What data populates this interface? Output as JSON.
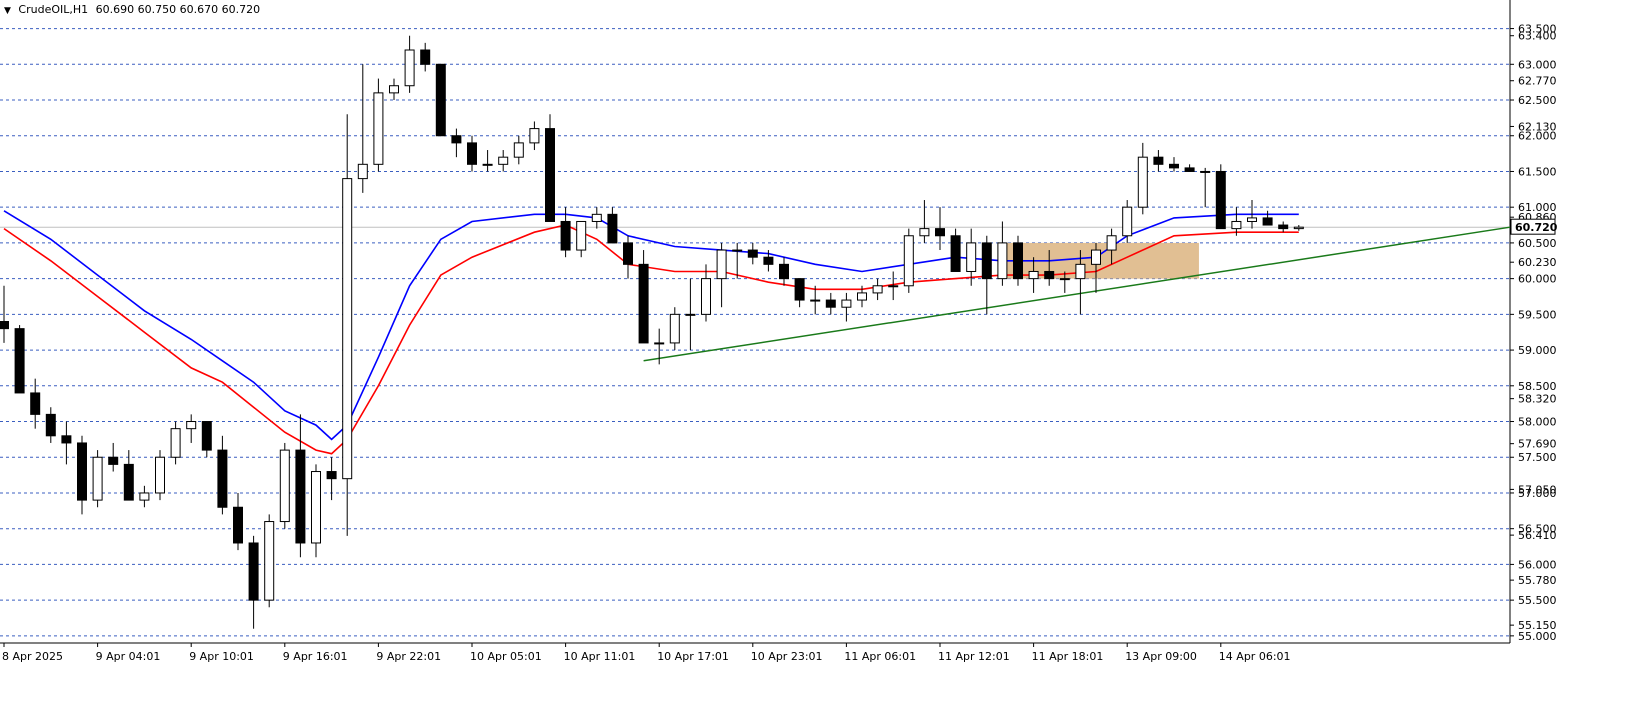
{
  "header": {
    "symbol": "CrudeOIL,H1",
    "ohlc": "60.690 60.750 60.670 60.720",
    "dropdown_icon": "triangle-down-icon"
  },
  "colors": {
    "bull": "#ffffff",
    "bear": "#000000",
    "ma_fast": "#0000ff",
    "ma_slow": "#ff0000",
    "trendline": "#1a7a1a",
    "zone": "#deb887",
    "grid": "#3b5fc0",
    "price_box": "#ffffff"
  },
  "chart_data": {
    "type": "candlestick",
    "ylim": [
      54.9,
      63.62
    ],
    "y_ticks": [
      "63.500",
      "63.400",
      "63.000",
      "62.770",
      "62.500",
      "62.130",
      "62.000",
      "61.500",
      "61.000",
      "60.860",
      "60.500",
      "60.230",
      "60.000",
      "59.500",
      "59.000",
      "58.500",
      "58.320",
      "58.000",
      "57.690",
      "57.500",
      "57.050",
      "57.000",
      "56.500",
      "56.410",
      "56.000",
      "55.780",
      "55.500",
      "55.150",
      "55.000"
    ],
    "grid_levels": [
      63.5,
      63.0,
      62.5,
      62.0,
      61.5,
      61.0,
      60.5,
      60.0,
      59.5,
      59.0,
      58.5,
      58.0,
      57.5,
      57.0,
      56.5,
      56.0,
      55.5,
      55.0
    ],
    "current_price": "60.720",
    "x_labels": [
      "8 Apr 2025",
      "9 Apr 04:01",
      "9 Apr 10:01",
      "9 Apr 16:01",
      "9 Apr 22:01",
      "10 Apr 05:01",
      "10 Apr 11:01",
      "10 Apr 17:01",
      "10 Apr 23:01",
      "11 Apr 06:01",
      "11 Apr 12:01",
      "11 Apr 18:01",
      "13 Apr 09:00",
      "14 Apr 06:01"
    ],
    "label_every": 6,
    "candles": [
      [
        59.4,
        59.9,
        59.1,
        59.3
      ],
      [
        59.3,
        59.35,
        58.4,
        58.4
      ],
      [
        58.4,
        58.6,
        57.9,
        58.1
      ],
      [
        58.1,
        58.2,
        57.7,
        57.8
      ],
      [
        57.8,
        58.0,
        57.4,
        57.7
      ],
      [
        57.7,
        57.8,
        56.7,
        56.9
      ],
      [
        56.9,
        57.6,
        56.8,
        57.5
      ],
      [
        57.5,
        57.7,
        57.3,
        57.4
      ],
      [
        57.4,
        57.6,
        56.9,
        56.9
      ],
      [
        56.9,
        57.1,
        56.8,
        57.0
      ],
      [
        57.0,
        57.6,
        56.9,
        57.5
      ],
      [
        57.5,
        58.0,
        57.4,
        57.9
      ],
      [
        57.9,
        58.1,
        57.7,
        58.0
      ],
      [
        58.0,
        58.0,
        57.5,
        57.6
      ],
      [
        57.6,
        57.8,
        56.7,
        56.8
      ],
      [
        56.8,
        57.0,
        56.2,
        56.3
      ],
      [
        56.3,
        56.4,
        55.1,
        55.5
      ],
      [
        55.5,
        56.7,
        55.4,
        56.6
      ],
      [
        56.6,
        57.7,
        56.5,
        57.6
      ],
      [
        57.6,
        58.1,
        56.1,
        56.3
      ],
      [
        56.3,
        57.4,
        56.1,
        57.3
      ],
      [
        57.3,
        57.5,
        56.9,
        57.2
      ],
      [
        57.2,
        62.3,
        56.4,
        61.4
      ],
      [
        61.4,
        63.0,
        61.2,
        61.6
      ],
      [
        61.6,
        62.8,
        61.5,
        62.6
      ],
      [
        62.6,
        62.8,
        62.5,
        62.7
      ],
      [
        62.7,
        63.4,
        62.6,
        63.2
      ],
      [
        63.2,
        63.3,
        62.9,
        63.0
      ],
      [
        63.0,
        63.0,
        62.0,
        62.0
      ],
      [
        62.0,
        62.1,
        61.7,
        61.9
      ],
      [
        61.9,
        62.0,
        61.5,
        61.6
      ],
      [
        61.6,
        61.8,
        61.5,
        61.6
      ],
      [
        61.6,
        61.8,
        61.5,
        61.7
      ],
      [
        61.7,
        62.0,
        61.6,
        61.9
      ],
      [
        61.9,
        62.2,
        61.8,
        62.1
      ],
      [
        62.1,
        62.3,
        60.8,
        60.8
      ],
      [
        60.8,
        61.0,
        60.3,
        60.4
      ],
      [
        60.4,
        60.8,
        60.3,
        60.8
      ],
      [
        60.8,
        61.0,
        60.7,
        60.9
      ],
      [
        60.9,
        61.0,
        60.5,
        60.5
      ],
      [
        60.5,
        60.6,
        60.0,
        60.2
      ],
      [
        60.2,
        60.4,
        59.1,
        59.1
      ],
      [
        59.1,
        59.3,
        58.8,
        59.1
      ],
      [
        59.1,
        59.6,
        59.0,
        59.5
      ],
      [
        59.5,
        60.0,
        59.0,
        59.5
      ],
      [
        59.5,
        60.2,
        59.4,
        60.0
      ],
      [
        60.0,
        60.5,
        59.6,
        60.4
      ],
      [
        60.4,
        60.5,
        60.0,
        60.4
      ],
      [
        60.4,
        60.5,
        60.2,
        60.3
      ],
      [
        60.3,
        60.4,
        60.1,
        60.2
      ],
      [
        60.2,
        60.3,
        59.9,
        60.0
      ],
      [
        60.0,
        60.0,
        59.6,
        59.7
      ],
      [
        59.7,
        59.9,
        59.5,
        59.7
      ],
      [
        59.7,
        59.8,
        59.5,
        59.6
      ],
      [
        59.6,
        59.8,
        59.4,
        59.7
      ],
      [
        59.7,
        59.9,
        59.6,
        59.8
      ],
      [
        59.8,
        60.0,
        59.7,
        59.9
      ],
      [
        59.9,
        60.1,
        59.7,
        59.9
      ],
      [
        59.9,
        60.7,
        59.8,
        60.6
      ],
      [
        60.6,
        61.1,
        60.5,
        60.7
      ],
      [
        60.7,
        61.0,
        60.4,
        60.6
      ],
      [
        60.6,
        60.7,
        60.2,
        60.1
      ],
      [
        60.1,
        60.7,
        59.9,
        60.5
      ],
      [
        60.5,
        60.6,
        59.5,
        60.0
      ],
      [
        60.0,
        60.8,
        59.9,
        60.5
      ],
      [
        60.5,
        60.6,
        59.9,
        60.0
      ],
      [
        60.0,
        60.3,
        59.8,
        60.1
      ],
      [
        60.1,
        60.4,
        59.9,
        60.0
      ],
      [
        60.0,
        60.1,
        59.8,
        60.0
      ],
      [
        60.0,
        60.4,
        59.5,
        60.2
      ],
      [
        60.2,
        60.5,
        59.8,
        60.4
      ],
      [
        60.4,
        60.7,
        60.2,
        60.6
      ],
      [
        60.6,
        61.1,
        60.5,
        61.0
      ],
      [
        61.0,
        61.9,
        60.9,
        61.7
      ],
      [
        61.7,
        61.8,
        61.5,
        61.6
      ],
      [
        61.6,
        61.7,
        61.5,
        61.55
      ],
      [
        61.55,
        61.6,
        61.5,
        61.5
      ],
      [
        61.5,
        61.55,
        61.0,
        61.5
      ],
      [
        61.5,
        61.6,
        60.7,
        60.7
      ],
      [
        60.7,
        61.0,
        60.6,
        60.8
      ],
      [
        60.8,
        61.1,
        60.7,
        60.85
      ],
      [
        60.85,
        60.95,
        60.75,
        60.75
      ],
      [
        60.75,
        60.8,
        60.65,
        60.7
      ],
      [
        60.7,
        60.75,
        60.67,
        60.72
      ]
    ],
    "ma_fast": [
      [
        0,
        60.95
      ],
      [
        3,
        60.55
      ],
      [
        6,
        60.05
      ],
      [
        9,
        59.55
      ],
      [
        12,
        59.15
      ],
      [
        14,
        58.85
      ],
      [
        16,
        58.55
      ],
      [
        18,
        58.15
      ],
      [
        20,
        57.95
      ],
      [
        21,
        57.75
      ],
      [
        22,
        57.95
      ],
      [
        24,
        58.9
      ],
      [
        26,
        59.9
      ],
      [
        28,
        60.55
      ],
      [
        30,
        60.8
      ],
      [
        34,
        60.9
      ],
      [
        36,
        60.9
      ],
      [
        38,
        60.85
      ],
      [
        40,
        60.6
      ],
      [
        43,
        60.45
      ],
      [
        46,
        60.4
      ],
      [
        49,
        60.35
      ],
      [
        52,
        60.2
      ],
      [
        55,
        60.1
      ],
      [
        58,
        60.2
      ],
      [
        61,
        60.3
      ],
      [
        64,
        60.25
      ],
      [
        67,
        60.25
      ],
      [
        70,
        60.3
      ],
      [
        72,
        60.6
      ],
      [
        75,
        60.85
      ],
      [
        79,
        60.9
      ],
      [
        83,
        60.9
      ]
    ],
    "ma_slow": [
      [
        0,
        60.7
      ],
      [
        3,
        60.25
      ],
      [
        6,
        59.75
      ],
      [
        9,
        59.25
      ],
      [
        12,
        58.75
      ],
      [
        14,
        58.55
      ],
      [
        16,
        58.2
      ],
      [
        18,
        57.85
      ],
      [
        20,
        57.6
      ],
      [
        21,
        57.55
      ],
      [
        22,
        57.75
      ],
      [
        24,
        58.5
      ],
      [
        26,
        59.35
      ],
      [
        28,
        60.05
      ],
      [
        30,
        60.3
      ],
      [
        34,
        60.65
      ],
      [
        36,
        60.75
      ],
      [
        38,
        60.55
      ],
      [
        40,
        60.2
      ],
      [
        43,
        60.1
      ],
      [
        46,
        60.1
      ],
      [
        49,
        59.95
      ],
      [
        52,
        59.85
      ],
      [
        55,
        59.85
      ],
      [
        58,
        59.95
      ],
      [
        61,
        60.0
      ],
      [
        64,
        60.05
      ],
      [
        67,
        60.05
      ],
      [
        70,
        60.1
      ],
      [
        72,
        60.3
      ],
      [
        75,
        60.6
      ],
      [
        79,
        60.65
      ],
      [
        83,
        60.65
      ]
    ],
    "trendline": [
      [
        41,
        58.85
      ],
      [
        100,
        60.72
      ]
    ],
    "zone": {
      "x0": 66.7,
      "x1": 79.4,
      "y0": 60.5,
      "y1": 60.0
    }
  }
}
